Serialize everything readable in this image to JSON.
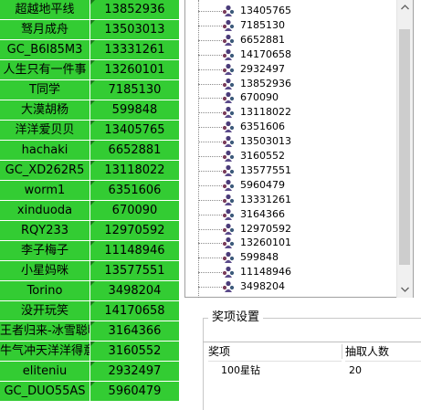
{
  "grid": {
    "rows": [
      {
        "name": "超越地平线",
        "value": "13852936"
      },
      {
        "name": "驽月成舟",
        "value": "13503013"
      },
      {
        "name": "GC_B6I85M3",
        "value": "13331261"
      },
      {
        "name": "人生只有一件事",
        "value": "13260101"
      },
      {
        "name": "T同学",
        "value": "7185130"
      },
      {
        "name": "大漠胡杨",
        "value": "599848"
      },
      {
        "name": "洋洋爱贝贝",
        "value": "13405765"
      },
      {
        "name": "hachaki",
        "value": "6652881"
      },
      {
        "name": "GC_XD262R5",
        "value": "13118022"
      },
      {
        "name": "worm1",
        "value": "6351606"
      },
      {
        "name": "xinduoda",
        "value": "670090"
      },
      {
        "name": "RQY233",
        "value": "12970592"
      },
      {
        "name": "李子梅子",
        "value": "11148946"
      },
      {
        "name": "小星妈咪",
        "value": "13577551"
      },
      {
        "name": "Torino",
        "value": "3498204"
      },
      {
        "name": "没开玩笑",
        "value": "14170658"
      },
      {
        "name": "王者归来-冰雪聪明",
        "value": "3164366"
      },
      {
        "name": "牛气冲天洋洋得意",
        "value": "3160552"
      },
      {
        "name": "eliteniu",
        "value": "2932497"
      },
      {
        "name": "GC_DUO55AS",
        "value": "5960479"
      }
    ]
  },
  "tree": {
    "items": [
      "13405765",
      "7185130",
      "6652881",
      "14170658",
      "2932497",
      "13852936",
      "670090",
      "13118022",
      "6351606",
      "13503013",
      "3160552",
      "13577551",
      "5960479",
      "13331261",
      "3164366",
      "12970592",
      "13260101",
      "599848",
      "11148946",
      "3498204"
    ],
    "icon": "user-group-icon"
  },
  "award": {
    "title": "奖项设置",
    "columns": [
      "奖项",
      "抽取人数"
    ],
    "rows": [
      {
        "prize": "100星钻",
        "count": "20"
      }
    ]
  },
  "colors": {
    "grid_bg": "#33cc33",
    "marker": "#1a7a1a"
  }
}
